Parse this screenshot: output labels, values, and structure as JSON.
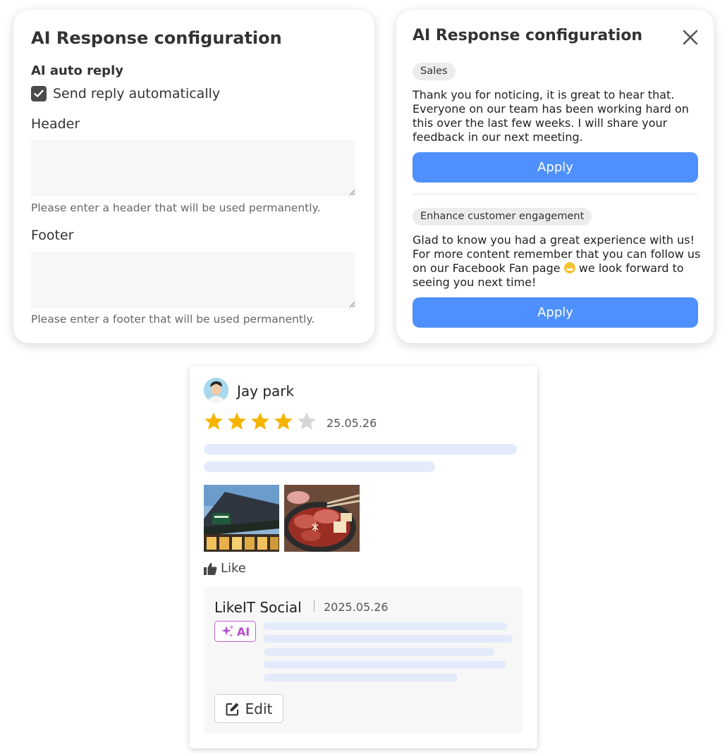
{
  "left_panel": {
    "title": "AI Response configuration",
    "auto_reply_label": "AI auto reply",
    "checkbox_label": "Send reply automatically",
    "checkbox_checked": true,
    "header_label": "Header",
    "header_value": "",
    "header_help": "Please enter a header that will be used permanently.",
    "footer_label": "Footer",
    "footer_value": "",
    "footer_help": "Please enter a footer that will be used permanently."
  },
  "right_panel": {
    "title": "AI Response configuration",
    "close_icon": "close-icon",
    "suggestions": [
      {
        "tag": "Sales",
        "text": "Thank you for noticing, it is great to hear that. Everyone on our team has been working hard on this over the last few weeks. I will share your feedback in our next meeting.",
        "button": "Apply"
      },
      {
        "tag": "Enhance customer engagement",
        "text_before": "Glad to know you had a great experience with us! For more content remember that you can follow us on our Facebook Fan page",
        "text_after": "we look forward to seeing you next time!",
        "button": "Apply"
      }
    ]
  },
  "review": {
    "reviewer": "Jay park",
    "rating": 4,
    "max_rating": 5,
    "date": "25.05.26",
    "like_label": "Like",
    "reply": {
      "author": "LikeIT Social",
      "date": "2025.05.26",
      "ai_badge": "AI",
      "edit_label": "Edit"
    }
  },
  "colors": {
    "accent": "#4d90fe",
    "star_filled": "#f5b400",
    "star_empty": "#d6d6d6",
    "ai_badge": "#b44fd1",
    "skeleton": "#e3ebfa"
  }
}
